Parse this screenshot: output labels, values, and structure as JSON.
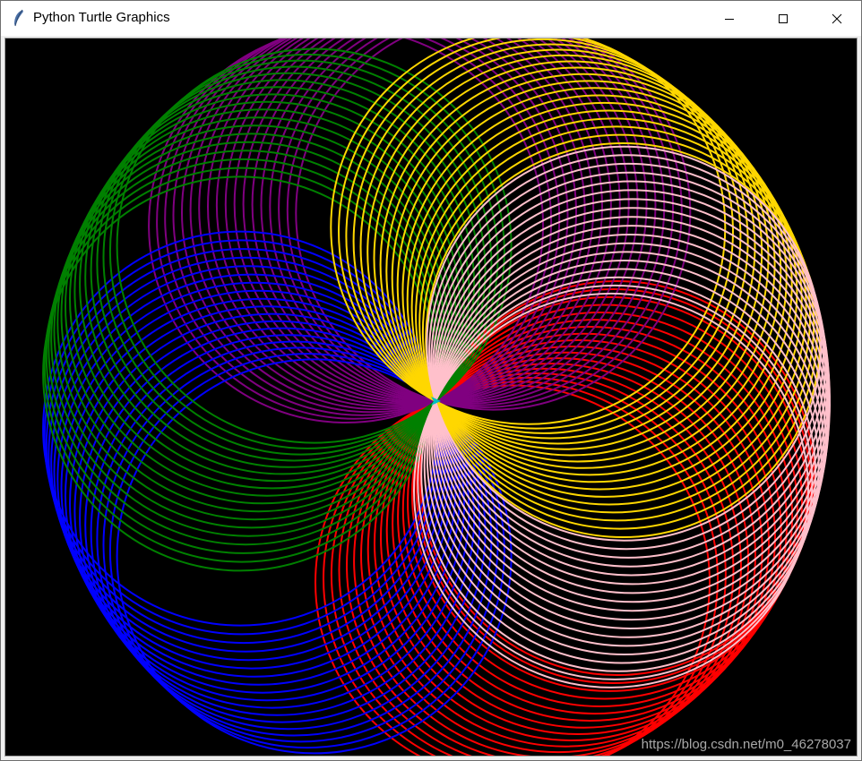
{
  "window": {
    "title": "Python Turtle Graphics",
    "icon": "feather-icon",
    "controls": {
      "minimize_icon": "minimize-icon",
      "maximize_icon": "maximize-icon",
      "close_icon": "close-icon"
    }
  },
  "canvas": {
    "background": "#000000",
    "drawing": {
      "circles_per_color": 18,
      "colors": [
        {
          "name": "red",
          "hex": "#ff0000"
        },
        {
          "name": "purple",
          "hex": "#800080"
        },
        {
          "name": "blue",
          "hex": "#0000ff"
        },
        {
          "name": "green",
          "hex": "#008000"
        },
        {
          "name": "yellow",
          "hex": "#ffd700"
        },
        {
          "name": "pink",
          "hex": "#ffc0cb"
        }
      ],
      "turtle_color": "#00bfbf"
    }
  },
  "watermark": {
    "text": "https://blog.csdn.net/m0_46278037"
  }
}
